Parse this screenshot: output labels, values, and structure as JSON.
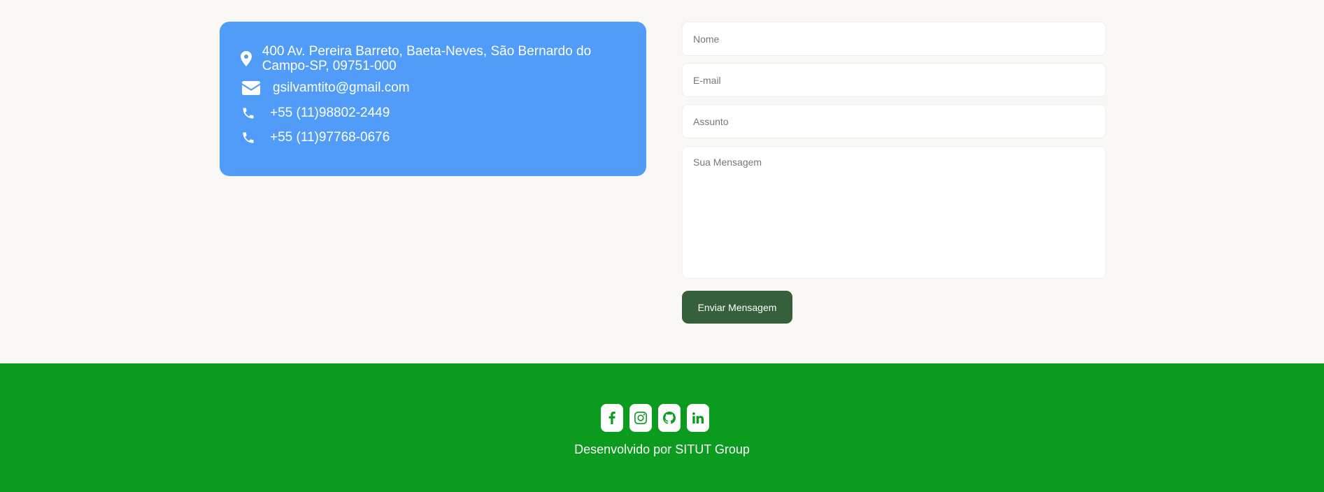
{
  "contact": {
    "address": "400 Av. Pereira Barreto, Baeta-Neves, São Bernardo do Campo-SP, 09751-000",
    "email": "gsilvamtito@gmail.com",
    "phone_1": "+55 (11)98802-2449",
    "phone_2": "+55 (11)97768-0676"
  },
  "form": {
    "name_placeholder": "Nome",
    "email_placeholder": "E-mail",
    "subject_placeholder": "Assunto",
    "message_placeholder": "Sua Mensagem",
    "submit_label": "Enviar Mensagem"
  },
  "footer": {
    "socials": [
      "facebook-icon",
      "instagram-icon",
      "github-icon",
      "linkedin-icon"
    ],
    "credit": "Desenvolvido por SITUT Group"
  },
  "colors": {
    "card": "#509cf8",
    "button": "#356039",
    "footer": "#0a9b1f",
    "background": "#f9f8f5"
  }
}
